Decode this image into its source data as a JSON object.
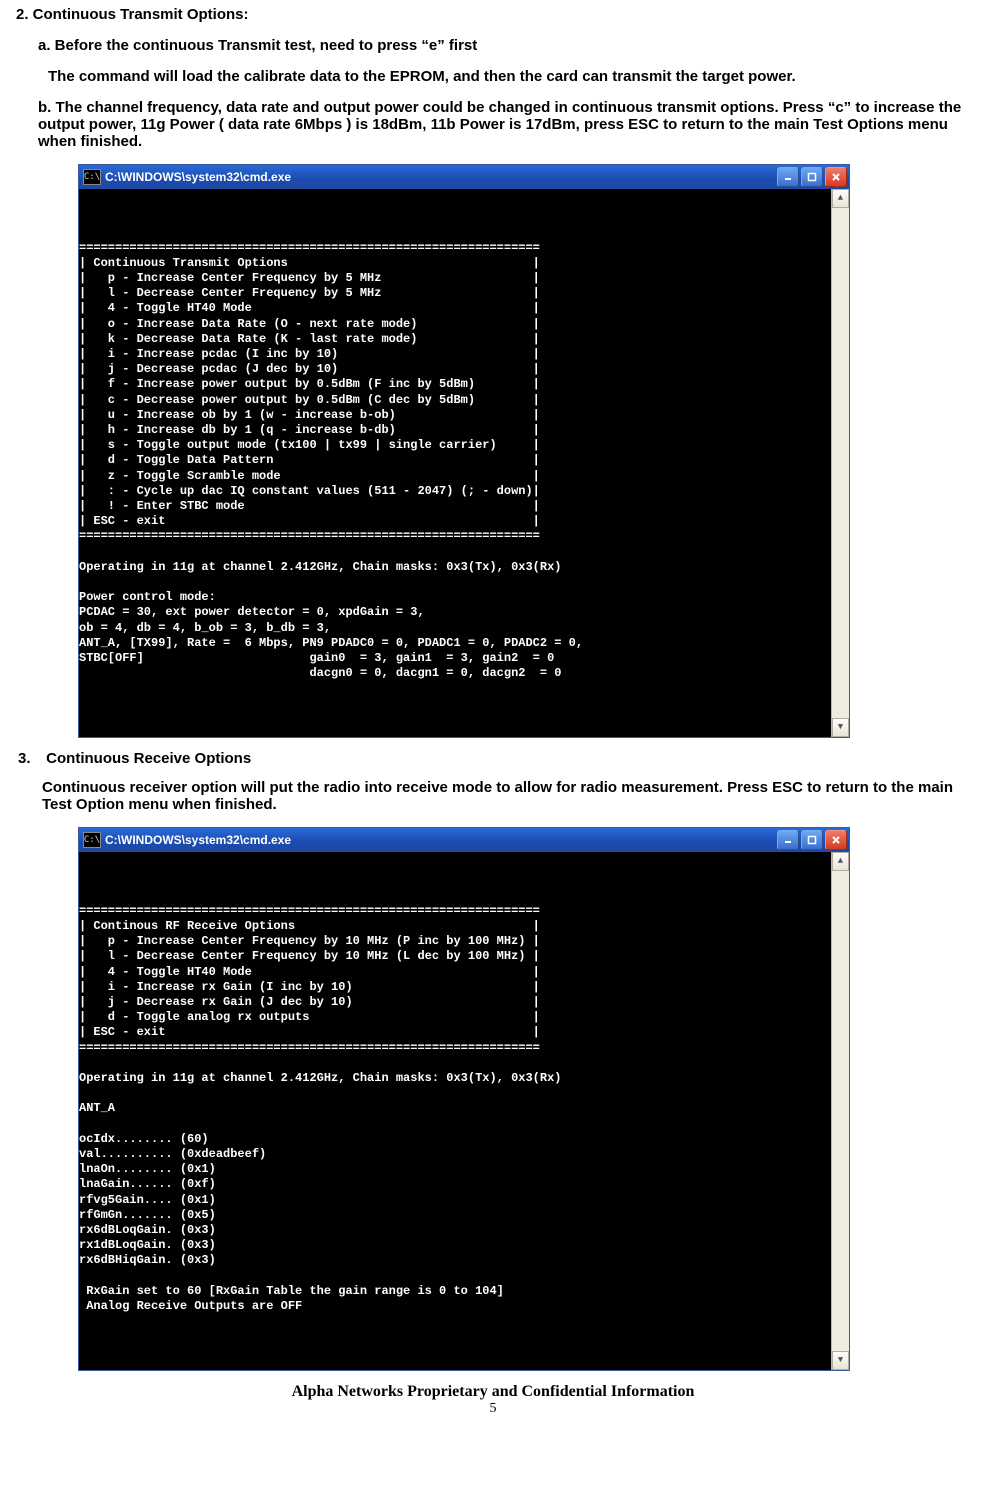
{
  "headings": {
    "section2": "2. Continuous Transmit Options:",
    "sub_a": "a. Before the continuous Transmit test, need to press “e” first",
    "note_a": "The command will load the calibrate data to the EPROM, and then the card can transmit the target power.",
    "sub_b": "b. The channel frequency, data rate and output power could be changed in continuous transmit options. Press “c” to increase the output power, 11g Power ( data rate 6Mbps ) is 18dBm, 11b Power is 17dBm, press ESC to return to the main Test Options menu when finished.",
    "section3_idx": "3.",
    "section3_title": "Continuous Receive Options",
    "section3_body": "Continuous receiver option will put the radio into receive mode to allow for radio measurement. Press ESC to return to the main Test Option menu when finished."
  },
  "titlebar": {
    "icon_glyph": "C:\\",
    "title": "C:\\WINDOWS\\system32\\cmd.exe"
  },
  "console1": "\n================================================================\n| Continuous Transmit Options                                  |\n|   p - Increase Center Frequency by 5 MHz                     |\n|   l - Decrease Center Frequency by 5 MHz                     |\n|   4 - Toggle HT40 Mode                                       |\n|   o - Increase Data Rate (O - next rate mode)                |\n|   k - Decrease Data Rate (K - last rate mode)                |\n|   i - Increase pcdac (I inc by 10)                           |\n|   j - Decrease pcdac (J dec by 10)                           |\n|   f - Increase power output by 0.5dBm (F inc by 5dBm)        |\n|   c - Decrease power output by 0.5dBm (C dec by 5dBm)        |\n|   u - Increase ob by 1 (w - increase b-ob)                   |\n|   h - Increase db by 1 (q - increase b-db)                   |\n|   s - Toggle output mode (tx100 | tx99 | single carrier)     |\n|   d - Toggle Data Pattern                                    |\n|   z - Toggle Scramble mode                                   |\n|   : - Cycle up dac IQ constant values (511 - 2047) (; - down)|\n|   ! - Enter STBC mode                                        |\n| ESC - exit                                                   |\n================================================================\n\nOperating in 11g at channel 2.412GHz, Chain masks: 0x3(Tx), 0x3(Rx)\n\nPower control mode:\nPCDAC = 30, ext power detector = 0, xpdGain = 3,\nob = 4, db = 4, b_ob = 3, b_db = 3,\nANT_A, [TX99], Rate =  6 Mbps, PN9 PDADC0 = 0, PDADC1 = 0, PDADC2 = 0,\nSTBC[OFF]                       gain0  = 3, gain1  = 3, gain2  = 0\n                                dacgn0 = 0, dacgn1 = 0, dacgn2  = 0",
  "console2": "\n================================================================\n| Continous RF Receive Options                                 |\n|   p - Increase Center Frequency by 10 MHz (P inc by 100 MHz) |\n|   l - Decrease Center Frequency by 10 MHz (L dec by 100 MHz) |\n|   4 - Toggle HT40 Mode                                       |\n|   i - Increase rx Gain (I inc by 10)                         |\n|   j - Decrease rx Gain (J dec by 10)                         |\n|   d - Toggle analog rx outputs                               |\n| ESC - exit                                                   |\n================================================================\n\nOperating in 11g at channel 2.412GHz, Chain masks: 0x3(Tx), 0x3(Rx)\n\nANT_A\n\nocIdx........ (60)\nval.......... (0xdeadbeef)\nlnaOn........ (0x1)\nlnaGain...... (0xf)\nrfvg5Gain.... (0x1)\nrfGmGn....... (0x5)\nrx6dBLoqGain. (0x3)\nrx1dBLoqGain. (0x3)\nrx6dBHiqGain. (0x3)\n\n RxGain set to 60 [RxGain Table the gain range is 0 to 104]\n Analog Receive Outputs are OFF\n",
  "footer": "Alpha Networks Proprietary and Confidential Information",
  "page_number": "5"
}
